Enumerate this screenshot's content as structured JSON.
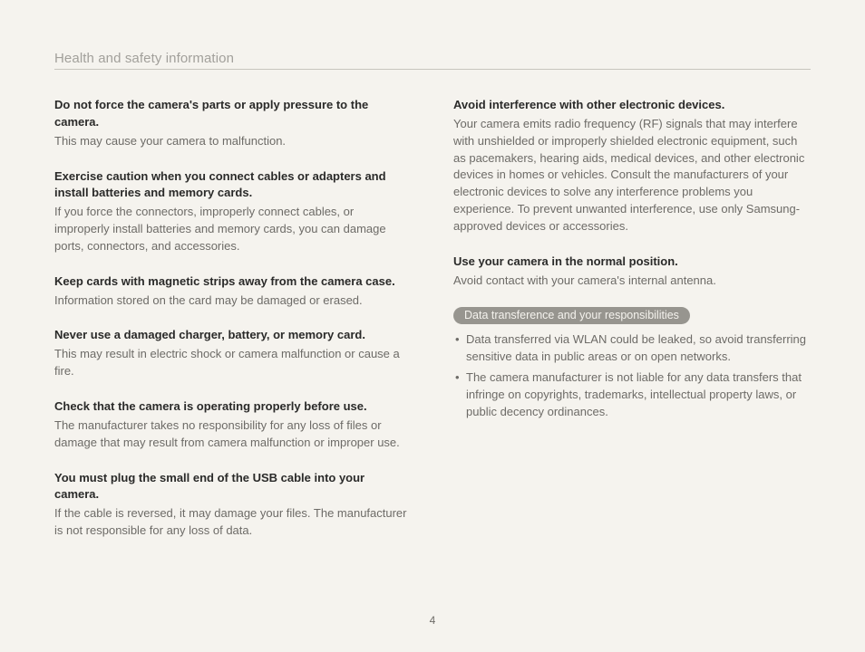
{
  "header": "Health and safety information",
  "page_number": "4",
  "left_column": [
    {
      "heading": "Do not force the camera's parts or apply pressure to the camera.",
      "body": "This may cause your camera to malfunction."
    },
    {
      "heading": "Exercise caution when you connect cables or adapters and install batteries and memory cards.",
      "body": "If you force the connectors, improperly connect cables, or improperly install batteries and memory cards, you can damage ports, connectors, and accessories."
    },
    {
      "heading": "Keep cards with magnetic strips away from the camera case.",
      "body": "Information stored on the card may be damaged or erased."
    },
    {
      "heading": "Never use a damaged charger, battery, or memory card.",
      "body": "This may result in electric shock or camera malfunction or cause a fire."
    },
    {
      "heading": "Check that the camera is operating properly before use.",
      "body": "The manufacturer takes no responsibility for any loss of files or damage that may result from camera malfunction or improper use."
    },
    {
      "heading": "You must plug the small end of the USB cable into your camera.",
      "body": "If the cable is reversed, it may damage your files. The manufacturer is not responsible for any loss of data."
    }
  ],
  "right_column": {
    "sections": [
      {
        "heading": "Avoid interference with other electronic devices.",
        "body": "Your camera emits radio frequency (RF) signals that may interfere with unshielded or improperly shielded electronic equipment, such as pacemakers, hearing aids, medical devices, and other electronic devices in homes or vehicles. Consult the manufacturers of your electronic devices to solve any interference problems you experience. To prevent unwanted interference, use only Samsung-approved devices or accessories."
      },
      {
        "heading": "Use your camera in the normal position.",
        "body": "Avoid contact with your camera's internal antenna."
      }
    ],
    "tag_section": {
      "tag": "Data transference and your responsibilities",
      "bullets": [
        "Data transferred via WLAN could be leaked, so avoid transferring sensitive data in public areas or on open networks.",
        "The camera manufacturer is not liable for any data transfers that infringe on copyrights, trademarks, intellectual property laws, or public decency ordinances."
      ]
    }
  }
}
